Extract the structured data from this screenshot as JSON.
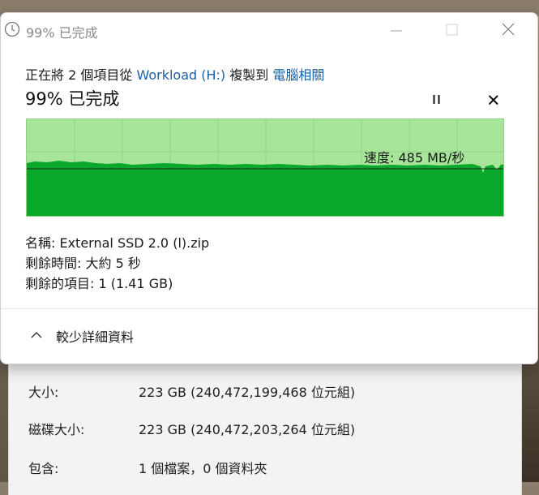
{
  "window": {
    "title": "99% 已完成"
  },
  "copy": {
    "prefix": "正在將 2 個項目從",
    "source": "Workload (H:)",
    "middle": "複製到",
    "destination": "電腦相關",
    "percent_title": "99% 已完成",
    "progress_percent": 99
  },
  "graph": {
    "speed_text": "速度: 485 MB/秒",
    "fill_color": "#08a82a",
    "background_color": "#a6e59a"
  },
  "details": {
    "name": "名稱: External SSD 2.0 (l).zip",
    "time_remaining": "剩餘時間: 大約 5 秒",
    "items_remaining": "剩餘的項目: 1 (1.41 GB)"
  },
  "toggle": {
    "label": "較少詳細資料"
  },
  "properties": {
    "rows": [
      {
        "label": "大小:",
        "value": "223 GB (240,472,199,468 位元組)"
      },
      {
        "label": "磁碟大小:",
        "value": "223 GB (240,472,203,264 位元組)"
      },
      {
        "label": "包含:",
        "value": "1 個檔案，0 個資料夾"
      }
    ]
  }
}
